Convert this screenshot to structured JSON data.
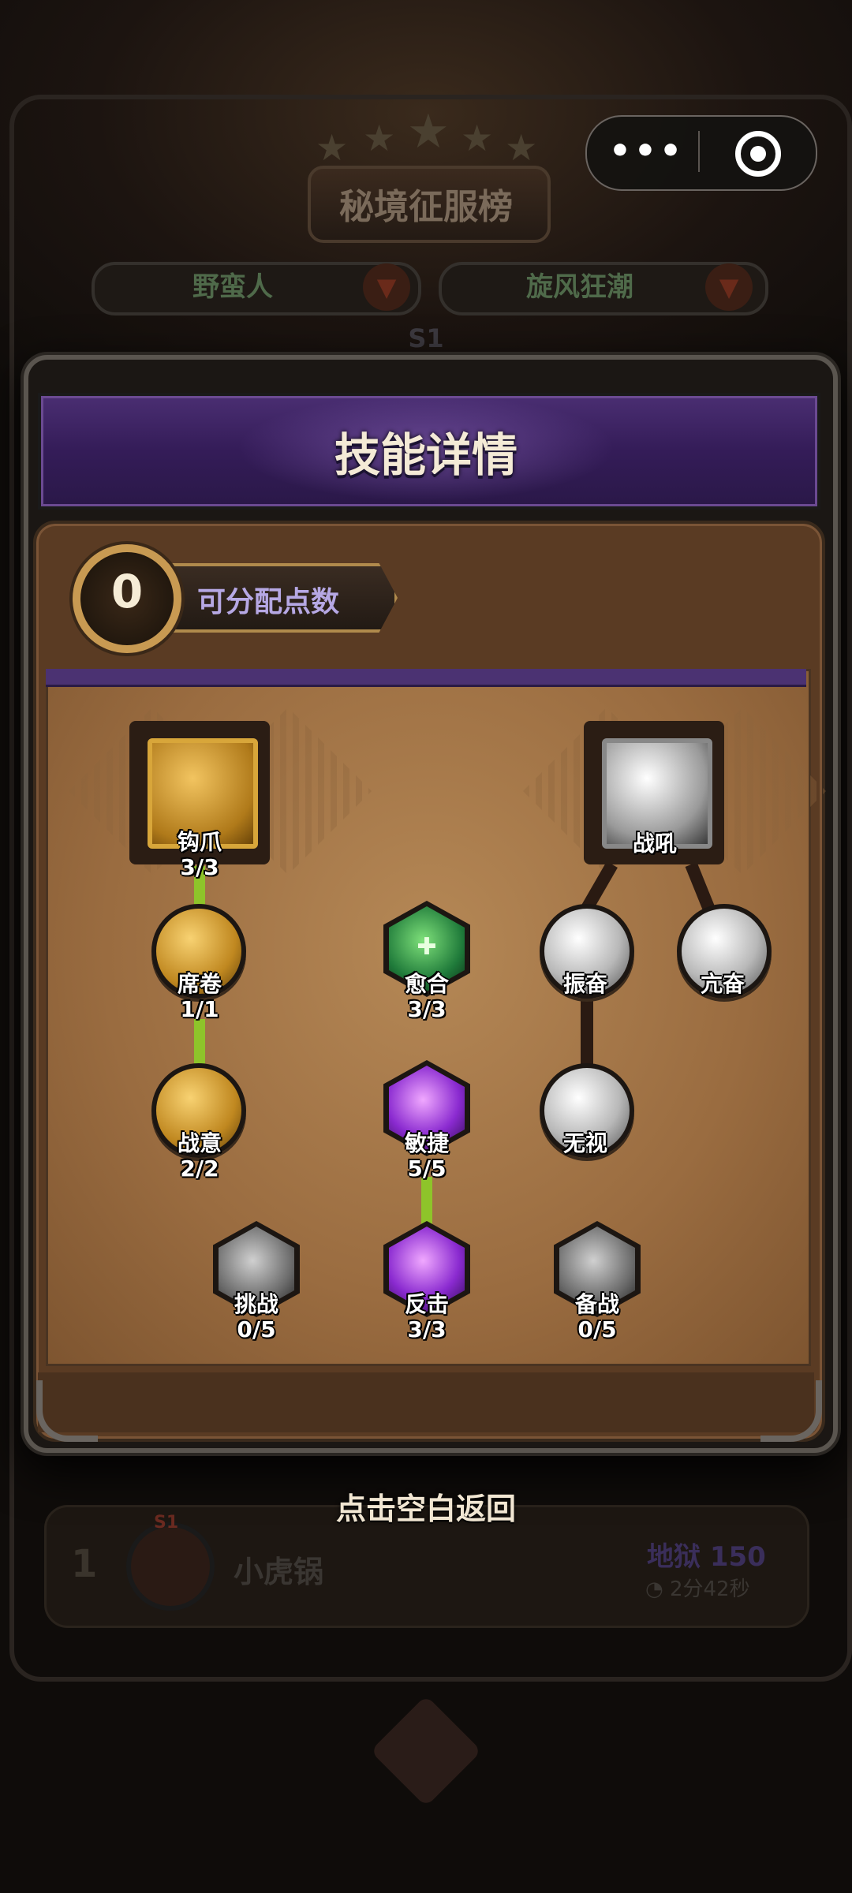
{
  "background": {
    "title": "秘境征服榜",
    "class_select": "野蛮人",
    "build_select": "旋风狂潮",
    "season": "S1",
    "row": {
      "rank": "1",
      "season_badge": "S1",
      "player_name": "小虎锅",
      "difficulty": "地狱 150",
      "time": "2分42秒"
    }
  },
  "capsule": {
    "more_glyph": "•••"
  },
  "dialog": {
    "title": "技能详情",
    "points_value": "0",
    "points_label": "可分配点数",
    "return_hint": "点击空白返回"
  },
  "skills": {
    "hook": {
      "name": "钩爪",
      "level": "3/3",
      "icon": "hook-claw-icon"
    },
    "warcry": {
      "name": "战吼",
      "level": "",
      "icon": "warcry-icon"
    },
    "xijuan": {
      "name": "席卷",
      "level": "1/1",
      "icon": "chain-sweep-icon"
    },
    "yuhe": {
      "name": "愈合",
      "level": "3/3",
      "icon": "heal-icon"
    },
    "zhenfen": {
      "name": "振奋",
      "level": "",
      "icon": "rally-icon"
    },
    "kangfen": {
      "name": "亢奋",
      "level": "",
      "icon": "frenzy-icon"
    },
    "zhanyi": {
      "name": "战意",
      "level": "2/2",
      "icon": "battle-will-icon"
    },
    "minjie": {
      "name": "敏捷",
      "level": "5/5",
      "icon": "agility-icon"
    },
    "wushi": {
      "name": "无视",
      "level": "",
      "icon": "ignore-icon"
    },
    "tiaozhan": {
      "name": "挑战",
      "level": "0/5",
      "icon": "challenge-icon"
    },
    "fanji": {
      "name": "反击",
      "level": "3/3",
      "icon": "counter-icon"
    },
    "beizhan": {
      "name": "备战",
      "level": "0/5",
      "icon": "ready-icon"
    }
  },
  "colors": {
    "active_link": "#8ec42a",
    "inactive_link": "#2a1a12",
    "header_purple": "#4a2e72",
    "gold_frame": "#d8a63a"
  }
}
